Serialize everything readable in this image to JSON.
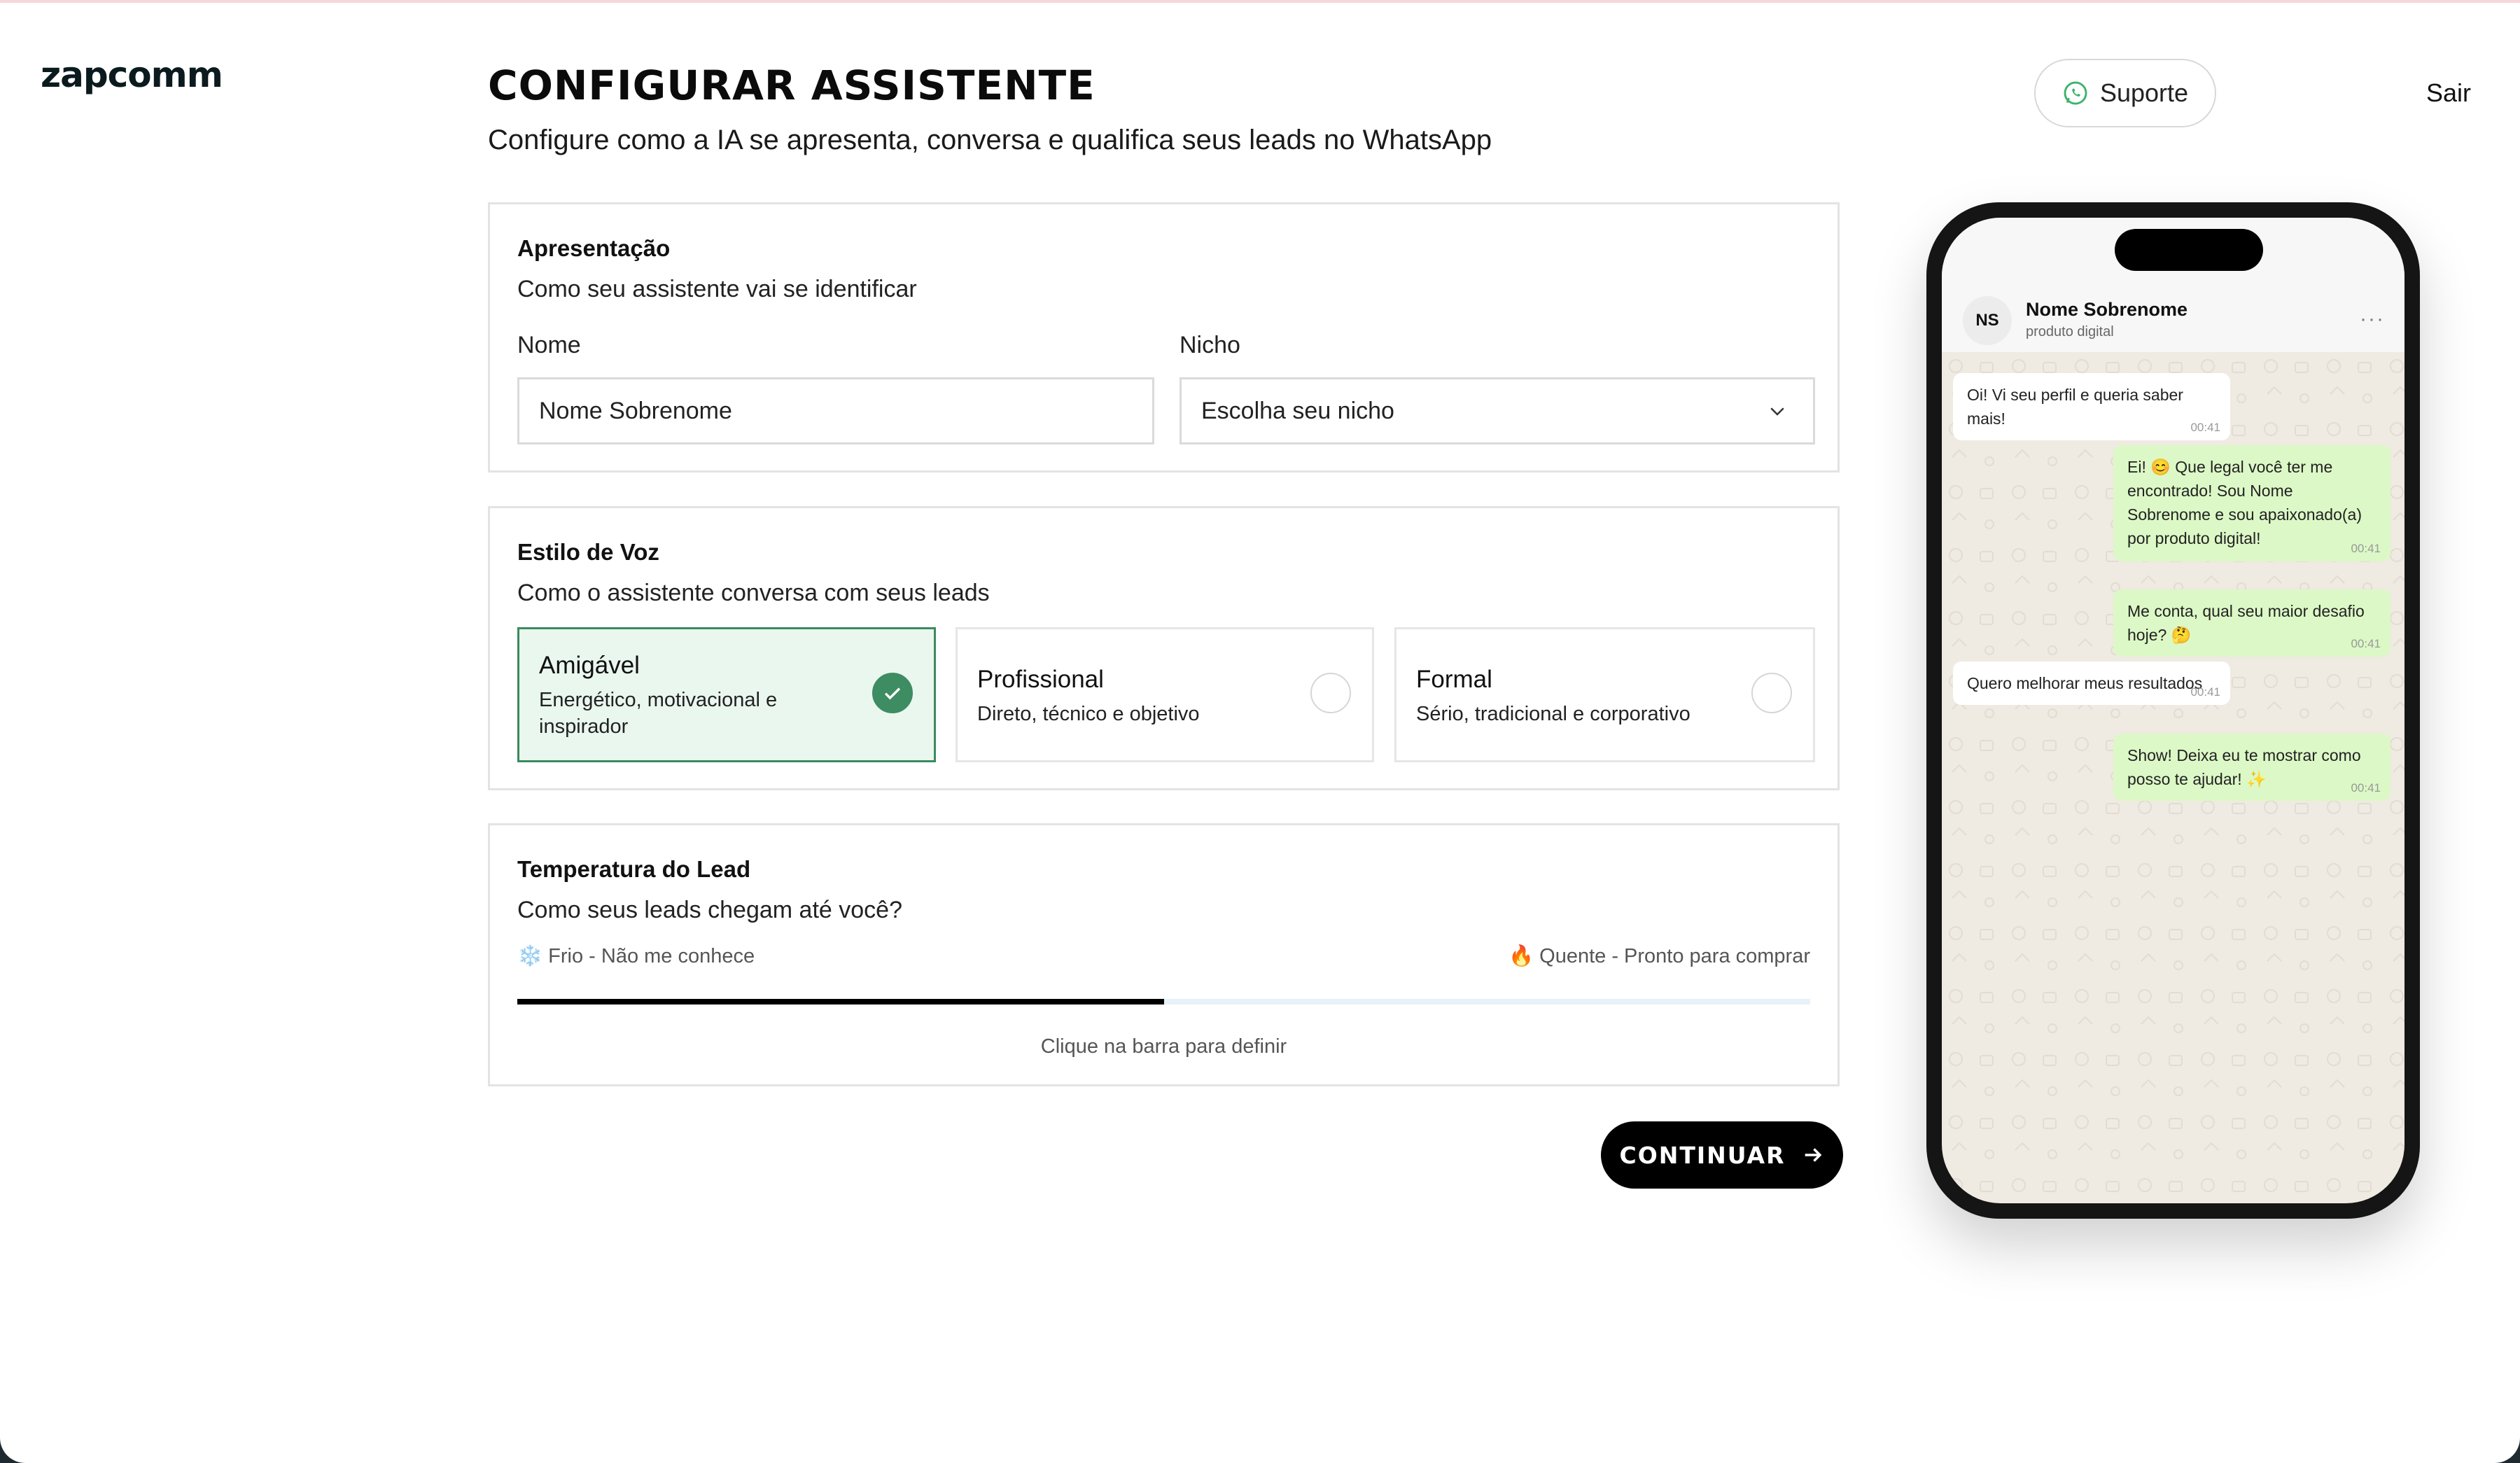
{
  "header": {
    "logo": "zapcomm",
    "support_label": "Suporte",
    "logout_label": "Sair"
  },
  "page": {
    "title": "CONFIGURAR ASSISTENTE",
    "subtitle": "Configure como a IA se apresenta, conversa e qualifica seus leads no WhatsApp"
  },
  "apresentacao": {
    "title": "Apresentação",
    "desc": "Como seu assistente vai se identificar",
    "name_label": "Nome",
    "name_value": "Nome Sobrenome",
    "niche_label": "Nicho",
    "niche_value": "Escolha seu nicho"
  },
  "estilo": {
    "title": "Estilo de Voz",
    "desc": "Como o assistente conversa com seus leads",
    "options": [
      {
        "name": "Amigável",
        "desc": "Energético, motivacional e inspirador",
        "selected": true
      },
      {
        "name": "Profissional",
        "desc": "Direto, técnico e objetivo",
        "selected": false
      },
      {
        "name": "Formal",
        "desc": "Sério, tradicional e corporativo",
        "selected": false
      }
    ]
  },
  "temperatura": {
    "title": "Temperatura do Lead",
    "desc": "Como seus leads chegam até você?",
    "left_label": "❄️ Frio - Não me conhece",
    "right_label": "🔥 Quente - Pronto para comprar",
    "value_percent": 50,
    "hint": "Clique na barra para definir"
  },
  "continue_label": "CONTINUAR",
  "preview": {
    "contact_initials": "NS",
    "contact_name": "Nome Sobrenome",
    "contact_sub": "produto digital",
    "menu": "···",
    "messages": [
      {
        "dir": "in",
        "text": "Oi! Vi seu perfil e queria saber mais!",
        "time": "00:41"
      },
      {
        "dir": "out",
        "text": "Ei! 😊 Que legal você ter me encontrado! Sou Nome Sobrenome e sou apaixonado(a) por produto digital!",
        "time": "00:41"
      },
      {
        "dir": "out",
        "text": "Me conta, qual seu maior desafio hoje? 🤔",
        "time": "00:41"
      },
      {
        "dir": "in",
        "text": "Quero melhorar meus resultados",
        "time": "00:41"
      },
      {
        "dir": "out",
        "text": "Show! Deixa eu te mostrar como posso te ajudar! ✨",
        "time": "00:41"
      }
    ]
  },
  "colors": {
    "accent_green": "#3e8c62",
    "selected_bg": "#eaf7ef",
    "bubble_out": "#dcf8c6",
    "chat_bg": "#efeae2"
  }
}
